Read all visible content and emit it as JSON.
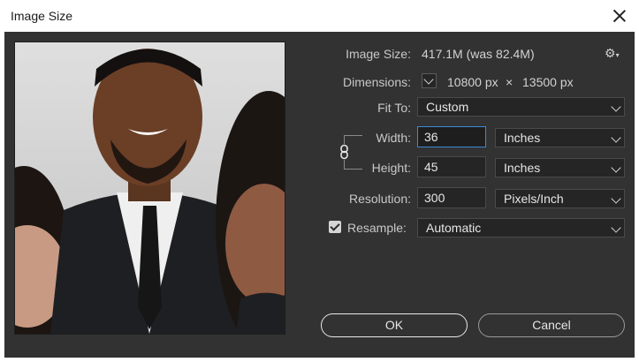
{
  "window": {
    "title": "Image Size"
  },
  "image_size": {
    "label": "Image Size:",
    "value": "417.1M (was 82.4M)"
  },
  "dimensions": {
    "label": "Dimensions:",
    "width_value": "10800 px",
    "times": "×",
    "height_value": "13500 px"
  },
  "fit_to": {
    "label": "Fit To:",
    "value": "Custom"
  },
  "width": {
    "label": "Width:",
    "value": "36",
    "unit": "Inches"
  },
  "height": {
    "label": "Height:",
    "value": "45",
    "unit": "Inches"
  },
  "resolution": {
    "label": "Resolution:",
    "value": "300",
    "unit": "Pixels/Inch"
  },
  "resample": {
    "label": "Resample:",
    "checked": true,
    "value": "Automatic"
  },
  "buttons": {
    "ok": "OK",
    "cancel": "Cancel"
  },
  "icons": {
    "gear": "gear-icon",
    "link": "link-icon",
    "close": "close-icon"
  },
  "colors": {
    "panel": "#323232",
    "focus": "#3c8ad6"
  }
}
